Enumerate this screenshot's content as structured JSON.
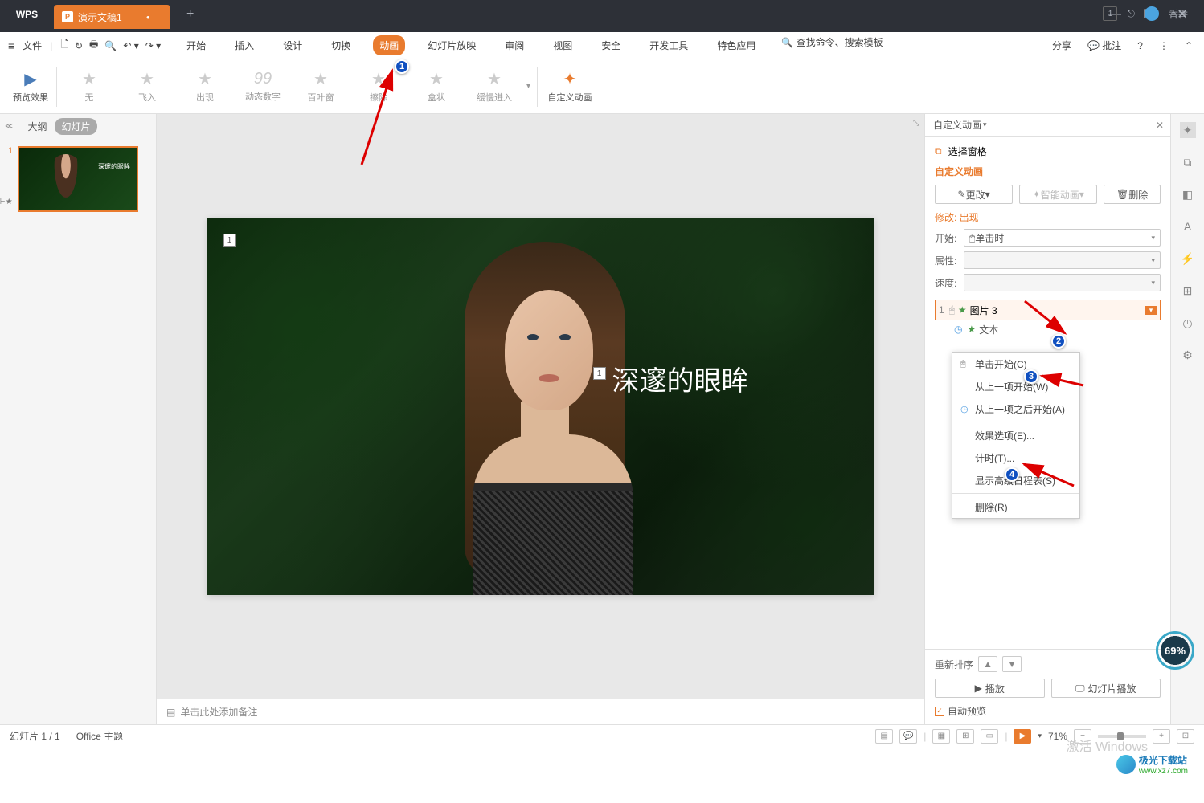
{
  "titlebar": {
    "logo": "WPS",
    "tab_name": "演示文稿1",
    "user_name": "香香",
    "badge": "1"
  },
  "toolbar": {
    "file": "文件",
    "menus": [
      "开始",
      "插入",
      "设计",
      "切换",
      "动画",
      "幻灯片放映",
      "审阅",
      "视图",
      "安全",
      "开发工具",
      "特色应用"
    ],
    "active_menu_index": 4,
    "search": "查找命令、搜索模板",
    "share": "分享",
    "comment": "批注"
  },
  "ribbon": {
    "preview": "预览效果",
    "effects": [
      "无",
      "飞入",
      "出现",
      "动态数字",
      "百叶窗",
      "擦除",
      "盒状",
      "缓慢进入"
    ],
    "custom": "自定义动画"
  },
  "panel": {
    "outline": "大纲",
    "slides": "幻灯片",
    "thumb_num": "1",
    "thumb_text": "深邃的眼眸"
  },
  "canvas": {
    "num1": "1",
    "num2": "1",
    "title": "深邃的眼眸"
  },
  "notes": {
    "placeholder": "单击此处添加备注"
  },
  "anim_pane": {
    "title": "自定义动画",
    "select_pane": "选择窗格",
    "section": "自定义动画",
    "change": "更改",
    "smart": "智能动画",
    "delete": "删除",
    "modify_label": "修改: 出现",
    "start_label": "开始:",
    "start_value": "单击时",
    "attr_label": "属性:",
    "speed_label": "速度:",
    "item1_num": "1",
    "item1_name": "图片 3",
    "item2_name": "文本",
    "reorder": "重新排序",
    "play": "播放",
    "slideshow": "幻灯片播放",
    "auto_preview": "自动预览"
  },
  "ctx": {
    "items": [
      "单击开始(C)",
      "从上一项开始(W)",
      "从上一项之后开始(A)",
      "效果选项(E)...",
      "计时(T)...",
      "显示高级日程表(S)",
      "删除(R)"
    ]
  },
  "status": {
    "slide_info": "幻灯片 1 / 1",
    "theme": "Office 主题",
    "zoom": "71%"
  },
  "progress": "69%",
  "watermark": {
    "name": "极光下载站",
    "url": "www.xz7.com"
  },
  "win_activate": "激活 Windows"
}
